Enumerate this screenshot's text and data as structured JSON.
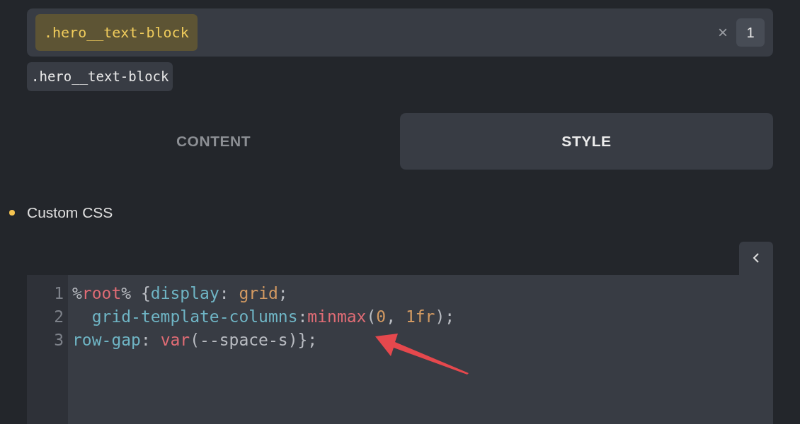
{
  "selector_field": {
    "chips": [
      ".hero__text-block"
    ],
    "clear": "×",
    "count": "1"
  },
  "selector_tag": ".hero__text-block",
  "tabs": [
    {
      "label": "CONTENT",
      "selected": false
    },
    {
      "label": "STYLE",
      "selected": true
    }
  ],
  "section": {
    "title": "Custom CSS",
    "color": "#f5c451"
  },
  "editor": {
    "lines": [
      {
        "number": "1",
        "tokens": [
          {
            "text": "%",
            "kind": "punct"
          },
          {
            "text": "root",
            "kind": "keyword"
          },
          {
            "text": "%",
            "kind": "punct"
          },
          {
            "text": " {",
            "kind": "punct"
          },
          {
            "text": "display",
            "kind": "property"
          },
          {
            "text": ": ",
            "kind": "punct"
          },
          {
            "text": "grid",
            "kind": "value"
          },
          {
            "text": ";",
            "kind": "punct"
          }
        ]
      },
      {
        "number": "2",
        "tokens": [
          {
            "text": "  grid-template-columns",
            "kind": "property"
          },
          {
            "text": ":",
            "kind": "punct"
          },
          {
            "text": "minmax",
            "kind": "keyword"
          },
          {
            "text": "(",
            "kind": "punct"
          },
          {
            "text": "0",
            "kind": "value"
          },
          {
            "text": ", ",
            "kind": "punct"
          },
          {
            "text": "1fr",
            "kind": "value"
          },
          {
            "text": ");",
            "kind": "punct"
          }
        ]
      },
      {
        "number": "3",
        "tokens": [
          {
            "text": "row-gap",
            "kind": "property"
          },
          {
            "text": ": ",
            "kind": "punct"
          },
          {
            "text": "var",
            "kind": "keyword"
          },
          {
            "text": "(--space-s)};",
            "kind": "punct"
          }
        ]
      }
    ]
  }
}
